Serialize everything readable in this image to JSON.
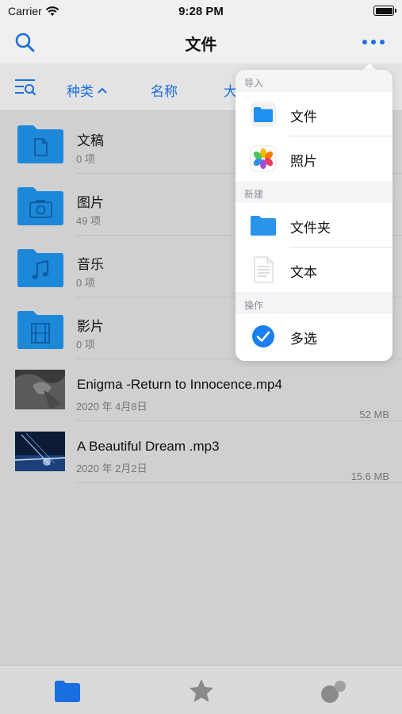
{
  "status": {
    "carrier": "Carrier",
    "time": "9:28 PM"
  },
  "nav": {
    "title": "文件"
  },
  "sort": {
    "kind": "种类",
    "name": "名称",
    "size_partial": "大"
  },
  "files": [
    {
      "name": "文稿",
      "sub": "0 项",
      "icon": "document-folder-icon"
    },
    {
      "name": "图片",
      "sub": "49 项",
      "icon": "camera-folder-icon"
    },
    {
      "name": "音乐",
      "sub": "0 项",
      "icon": "music-folder-icon"
    },
    {
      "name": "影片",
      "sub": "0 项",
      "icon": "film-folder-icon"
    }
  ],
  "media": [
    {
      "name": "Enigma -Return to Innocence.mp4",
      "date": "2020 年 4月8日",
      "size": "52 MB"
    },
    {
      "name": "A Beautiful Dream .mp3",
      "date": "2020 年 2月2日",
      "size": "15.6 MB"
    }
  ],
  "menu": {
    "import_header": "导入",
    "import_file": "文件",
    "import_photo": "照片",
    "new_header": "新建",
    "new_folder": "文件夹",
    "new_text": "文本",
    "action_header": "操作",
    "multi_select": "多选"
  },
  "colors": {
    "accent": "#1a6ee0",
    "folder": "#1e88d8",
    "dim_background": "#d0d0d0"
  }
}
